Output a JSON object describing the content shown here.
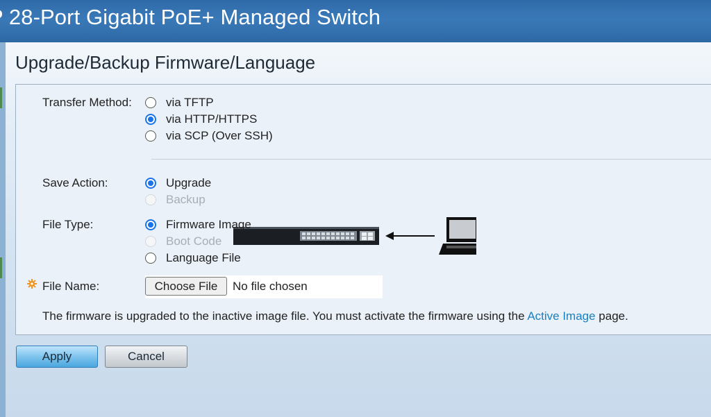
{
  "header": {
    "title": "P 28-Port Gigabit PoE+ Managed Switch"
  },
  "page": {
    "title": "Upgrade/Backup Firmware/Language"
  },
  "form": {
    "transfer_method": {
      "label": "Transfer Method:",
      "options": [
        {
          "label": "via TFTP",
          "checked": false,
          "disabled": false
        },
        {
          "label": "via HTTP/HTTPS",
          "checked": true,
          "disabled": false
        },
        {
          "label": "via SCP (Over SSH)",
          "checked": false,
          "disabled": false
        }
      ]
    },
    "save_action": {
      "label": "Save Action:",
      "options": [
        {
          "label": "Upgrade",
          "checked": true,
          "disabled": false
        },
        {
          "label": "Backup",
          "checked": false,
          "disabled": true
        }
      ]
    },
    "file_type": {
      "label": "File Type:",
      "options": [
        {
          "label": "Firmware Image",
          "checked": true,
          "disabled": false
        },
        {
          "label": "Boot Code",
          "checked": false,
          "disabled": true
        },
        {
          "label": "Language File",
          "checked": false,
          "disabled": false
        }
      ]
    },
    "file_name": {
      "label": "File Name:",
      "choose_button": "Choose File",
      "status": "No file chosen"
    },
    "info": {
      "text_before": "The firmware is upgraded to the inactive image file. You must activate the firmware using the ",
      "link": "Active Image",
      "text_after": " page."
    }
  },
  "actions": {
    "apply": "Apply",
    "cancel": "Cancel"
  },
  "icons": {
    "required": "required-gear-icon",
    "switch": "switch-device-icon",
    "laptop": "laptop-icon",
    "arrow": "arrow-left-icon"
  },
  "colors": {
    "header": "#2f6aa8",
    "accent": "#1a73e8",
    "link": "#1b7fc0"
  }
}
